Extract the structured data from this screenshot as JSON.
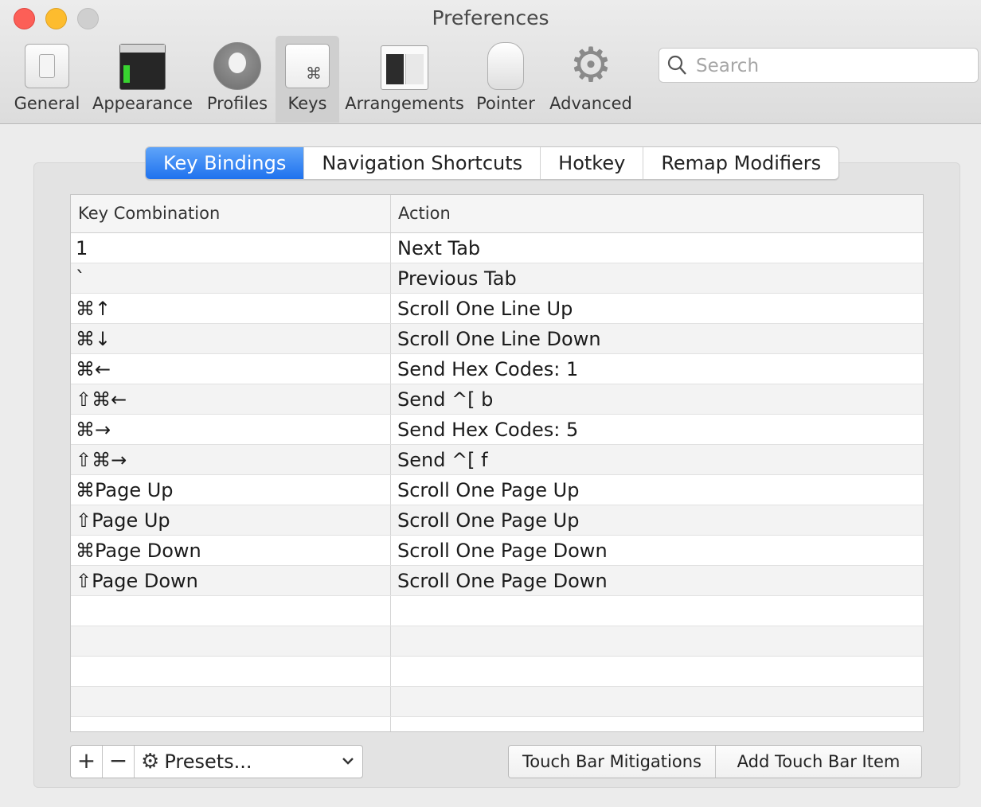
{
  "window": {
    "title": "Preferences"
  },
  "toolbar": {
    "items": [
      {
        "label": "General",
        "icon": "general-icon"
      },
      {
        "label": "Appearance",
        "icon": "appearance-icon"
      },
      {
        "label": "Profiles",
        "icon": "profiles-icon"
      },
      {
        "label": "Keys",
        "icon": "keys-icon",
        "selected": true
      },
      {
        "label": "Arrangements",
        "icon": "arrangements-icon"
      },
      {
        "label": "Pointer",
        "icon": "pointer-icon"
      },
      {
        "label": "Advanced",
        "icon": "advanced-icon"
      }
    ],
    "keys_glyph": "⌘",
    "advanced_glyph": "⚙"
  },
  "search": {
    "placeholder": "Search",
    "value": "",
    "icon": "search-icon"
  },
  "tabs": [
    {
      "label": "Key Bindings",
      "active": true
    },
    {
      "label": "Navigation Shortcuts"
    },
    {
      "label": "Hotkey"
    },
    {
      "label": "Remap Modifiers"
    }
  ],
  "table": {
    "columns": [
      "Key Combination",
      "Action"
    ],
    "rows": [
      {
        "key": "1",
        "action": "Next Tab"
      },
      {
        "key": "`",
        "action": "Previous Tab"
      },
      {
        "key": "⌘↑",
        "action": "Scroll One Line Up"
      },
      {
        "key": "⌘↓",
        "action": "Scroll One Line Down"
      },
      {
        "key": "⌘←",
        "action": "Send Hex Codes: 1"
      },
      {
        "key": "⇧⌘←",
        "action": "Send ^[ b"
      },
      {
        "key": "⌘→",
        "action": "Send Hex Codes: 5"
      },
      {
        "key": "⇧⌘→",
        "action": "Send ^[ f"
      },
      {
        "key": "⌘Page Up",
        "action": "Scroll One Page Up"
      },
      {
        "key": "⇧Page Up",
        "action": "Scroll One Page Up"
      },
      {
        "key": "⌘Page Down",
        "action": "Scroll One Page Down"
      },
      {
        "key": "⇧Page Down",
        "action": "Scroll One Page Down"
      },
      {
        "key": "",
        "action": ""
      },
      {
        "key": "",
        "action": ""
      },
      {
        "key": "",
        "action": ""
      },
      {
        "key": "",
        "action": ""
      },
      {
        "key": "",
        "action": ""
      }
    ]
  },
  "footer": {
    "add_glyph": "+",
    "remove_glyph": "−",
    "presets_label": "Presets...",
    "presets_gear": "⚙",
    "presets_chevron": "⌄",
    "touch_bar_mitigations": "Touch Bar Mitigations",
    "add_touch_bar_item": "Add Touch Bar Item"
  },
  "colors": {
    "accent": "#1f72ee",
    "close": "#fc5f57",
    "minimize": "#fdbc2e",
    "zoom_disabled": "#cfcfcf"
  }
}
